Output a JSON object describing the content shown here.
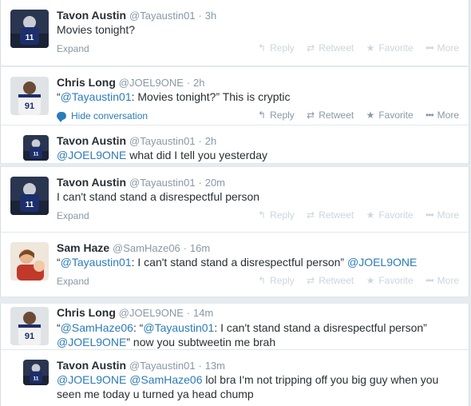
{
  "actions": {
    "reply": "Reply",
    "retweet": "Retweet",
    "favorite": "Favorite",
    "more": "More",
    "expand": "Expand",
    "hide_conversation": "Hide conversation"
  },
  "icons": {
    "reply": "reply-arrow-icon",
    "retweet": "retweet-icon",
    "favorite": "star-icon",
    "more": "ellipsis-icon",
    "hide_conversation": "speech-bubble-icon"
  },
  "colors": {
    "link": "#2b7bb9",
    "muted": "#8899a6",
    "faded": "#ccd6dd"
  },
  "tweets": [
    {
      "name": "Tavon Austin",
      "handle": "@Tayaustin01",
      "time": "3h",
      "text": "Movies tonight?"
    },
    {
      "name": "Chris Long",
      "handle": "@JOEL9ONE",
      "time": "2h",
      "quote_open": "“",
      "mention": "@Tayaustin01",
      "rest": ": Movies tonight?” This is cryptic"
    },
    {
      "name": "Tavon Austin",
      "handle": "@Tayaustin01",
      "time": "2h",
      "mention": "@JOEL9ONE",
      "rest": " what did I tell you yesterday"
    },
    {
      "name": "Tavon Austin",
      "handle": "@Tayaustin01",
      "time": "20m",
      "text": "I can't stand stand a disrespectful person"
    },
    {
      "name": "Sam Haze",
      "handle": "@SamHaze06",
      "time": "16m",
      "quote_open": "“",
      "mention": "@Tayaustin01",
      "rest": ": I can't stand stand a disrespectful person” ",
      "mention2": "@JOEL9ONE"
    },
    {
      "name": "Chris Long",
      "handle": "@JOEL9ONE",
      "time": "14m",
      "line1_open": "“",
      "mention1": "@SamHaze06",
      "mid1": ": “",
      "mention2": "@Tayaustin01",
      "rest1": ": I can't stand stand a disrespectful person”",
      "mention3": "@JOEL9ONE",
      "rest2": "” now you subtweetin me brah"
    },
    {
      "name": "Tavon Austin",
      "handle": "@Tayaustin01",
      "time": "13m",
      "mention1": "@JOEL9ONE",
      "space": " ",
      "mention2": "@SamHaze06",
      "rest1": " lol bra I'm not tripping off you big guy when you",
      "line2": "seen me today u turned ya head chump"
    }
  ]
}
